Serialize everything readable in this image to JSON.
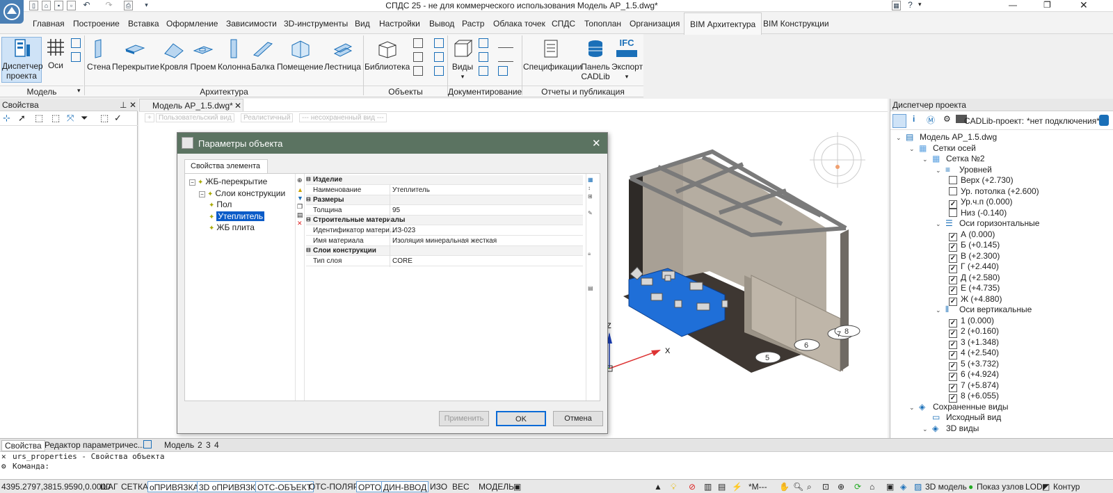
{
  "window": {
    "title": "СПДС 25 - не для коммерческого использования Модель АР_1.5.dwg*"
  },
  "menu": [
    "Главная",
    "Построение",
    "Вставка",
    "Оформление",
    "Зависимости",
    "3D-инструменты",
    "Вид",
    "Настройки",
    "Вывод",
    "Растр",
    "Облака точек",
    "СПДС",
    "Топоплан",
    "Организация",
    "BIM Архитектура",
    "BIM Конструкции"
  ],
  "ribbon": {
    "model_group": {
      "label": "Модель",
      "dispatcher": "Диспетчер",
      "dispatcher2": "проекта",
      "axes": "Оси"
    },
    "arch_group": {
      "label": "Архитектура",
      "items": [
        "Стена",
        "Перекрытие",
        "Кровля",
        "Проем",
        "Колонна",
        "Балка",
        "Помещение",
        "Лестница"
      ]
    },
    "objects_group": {
      "label": "Объекты",
      "library": "Библиотека"
    },
    "doc_group": {
      "label": "Документирование",
      "views": "Виды"
    },
    "reports_group": {
      "label": "Отчеты и публикация",
      "specs": "Спецификации",
      "panel": "Панель",
      "panel2": "CADLib",
      "export": "Экспорт",
      "ifc": "IFC"
    }
  },
  "props_panel": {
    "title": "Свойства"
  },
  "viewport": {
    "tab": "Модель АР_1.5.dwg*",
    "view_bar": [
      "Пользовательский вид",
      "Реалистичный",
      "--- несохраненный вид ---"
    ],
    "axis_z": "Z",
    "axis_x": "X",
    "axis_marks": [
      "5",
      "6",
      "7",
      "8"
    ]
  },
  "project_panel": {
    "title": "Диспетчер проекта",
    "cadlib_label": "CADLib-проект:",
    "cadlib_value": "*нет подключения*",
    "tree": [
      {
        "label": "Модель АР_1.5.dwg",
        "level": 0,
        "type": "file"
      },
      {
        "label": "Сетки осей",
        "level": 1,
        "type": "grid"
      },
      {
        "label": "Сетка №2",
        "level": 2,
        "type": "grid"
      },
      {
        "label": "Уровней",
        "level": 3,
        "type": "levels"
      },
      {
        "label": "Верх (+2.730)",
        "level": 4,
        "type": "check",
        "checked": false
      },
      {
        "label": "Ур. потолка (+2.600)",
        "level": 4,
        "type": "check",
        "checked": false
      },
      {
        "label": "Ур.ч.п (0.000)",
        "level": 4,
        "type": "check",
        "checked": true
      },
      {
        "label": "Низ (-0.140)",
        "level": 4,
        "type": "check",
        "checked": false
      },
      {
        "label": "Оси горизонтальные",
        "level": 3,
        "type": "haxes"
      },
      {
        "label": "А (0.000)",
        "level": 4,
        "type": "check",
        "checked": true
      },
      {
        "label": "Б (+0.145)",
        "level": 4,
        "type": "check",
        "checked": true
      },
      {
        "label": "В (+2.300)",
        "level": 4,
        "type": "check",
        "checked": true
      },
      {
        "label": "Г (+2.440)",
        "level": 4,
        "type": "check",
        "checked": true
      },
      {
        "label": "Д (+2.580)",
        "level": 4,
        "type": "check",
        "checked": true
      },
      {
        "label": "Е (+4.735)",
        "level": 4,
        "type": "check",
        "checked": true
      },
      {
        "label": "Ж (+4.880)",
        "level": 4,
        "type": "check",
        "checked": true
      },
      {
        "label": "Оси вертикальные",
        "level": 3,
        "type": "vaxes"
      },
      {
        "label": "1 (0.000)",
        "level": 4,
        "type": "check",
        "checked": true
      },
      {
        "label": "2 (+0.160)",
        "level": 4,
        "type": "check",
        "checked": true
      },
      {
        "label": "3 (+1.348)",
        "level": 4,
        "type": "check",
        "checked": true
      },
      {
        "label": "4 (+2.540)",
        "level": 4,
        "type": "check",
        "checked": true
      },
      {
        "label": "5 (+3.732)",
        "level": 4,
        "type": "check",
        "checked": true
      },
      {
        "label": "6 (+4.924)",
        "level": 4,
        "type": "check",
        "checked": true
      },
      {
        "label": "7 (+5.874)",
        "level": 4,
        "type": "check",
        "checked": true
      },
      {
        "label": "8 (+6.055)",
        "level": 4,
        "type": "check",
        "checked": true
      },
      {
        "label": "Сохраненные виды",
        "level": 1,
        "type": "views"
      },
      {
        "label": "Исходный вид",
        "level": 2,
        "type": "view"
      },
      {
        "label": "3D виды",
        "level": 2,
        "type": "views"
      }
    ]
  },
  "dialog": {
    "title": "Параметры объекта",
    "tab": "Свойства элемента",
    "tree": [
      {
        "label": "ЖБ-перекрытие",
        "level": 0
      },
      {
        "label": "Слои конструкции",
        "level": 1
      },
      {
        "label": "Пол",
        "level": 2
      },
      {
        "label": "Утеплитель",
        "level": 2,
        "selected": true
      },
      {
        "label": "ЖБ плита",
        "level": 2
      }
    ],
    "grid": [
      {
        "cat": "Изделие"
      },
      {
        "k": "Наименование",
        "v": "Утеплитель"
      },
      {
        "cat": "Размеры"
      },
      {
        "k": "Толщина",
        "v": "95"
      },
      {
        "cat": "Строительные материалы"
      },
      {
        "k": "Идентификатор матери...",
        "v": "ИЗ-023"
      },
      {
        "k": "Имя материала",
        "v": "Изоляция минеральная жесткая"
      },
      {
        "cat": "Слои конструкции"
      },
      {
        "k": "Тип слоя",
        "v": "CORE"
      }
    ],
    "apply": "Применить",
    "ok": "OK",
    "cancel": "Отмена"
  },
  "bottom_tabs": {
    "left1": "Свойства",
    "left2": "Редактор параметричес...",
    "model": "Модель",
    "layouts": [
      "2",
      "3",
      "4"
    ]
  },
  "command": {
    "line1": "urs_properties - Свойства объекта",
    "prompt": "Команда:"
  },
  "status": {
    "coords": "4395.2797,3815.9590,0.0000",
    "toggles": [
      {
        "label": "ШАГ",
        "on": false
      },
      {
        "label": "СЕТКА",
        "on": false
      },
      {
        "label": "оПРИВЯЗКА",
        "on": true
      },
      {
        "label": "3D оПРИВЯЗКА",
        "on": true
      },
      {
        "label": "ОТС-ОБЪЕКТ",
        "on": true
      },
      {
        "label": "ОТС-ПОЛЯР",
        "on": false
      },
      {
        "label": "ОРТО",
        "on": true
      },
      {
        "label": "ДИН-ВВОД",
        "on": true
      },
      {
        "label": "ИЗО",
        "on": false
      },
      {
        "label": "ВЕС",
        "on": false
      }
    ],
    "model": "МОДЕЛЬ",
    "scale": "*M---",
    "model3d": "3D модель",
    "nodes": "Показ узлов",
    "lod": "LOD",
    "contour": "Контур"
  }
}
